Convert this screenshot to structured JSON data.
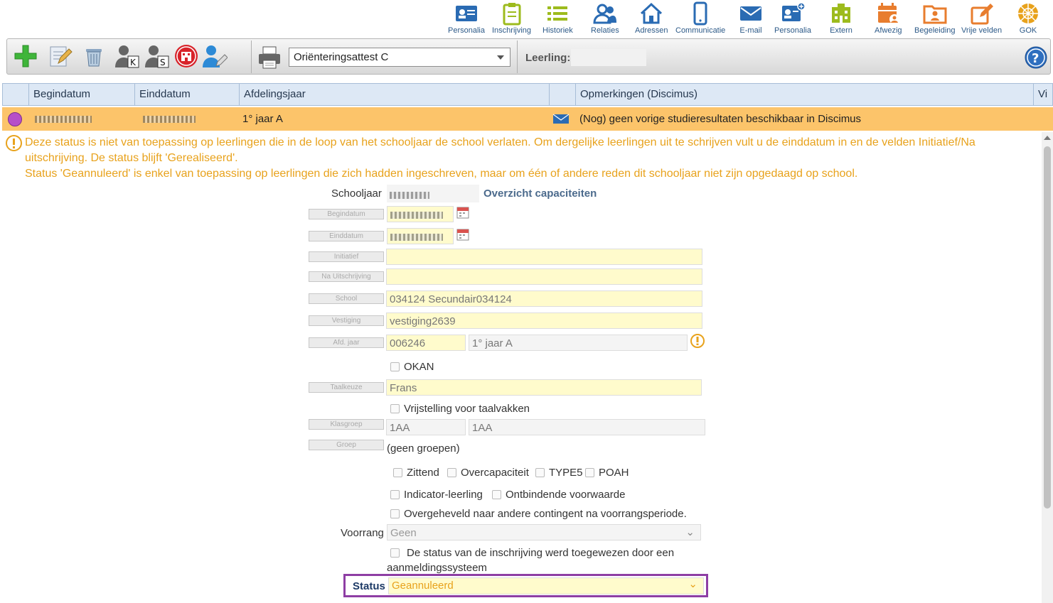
{
  "nav": [
    {
      "label": "Personalia",
      "icon": "id-card-icon"
    },
    {
      "label": "Inschrijving",
      "icon": "clipboard-icon"
    },
    {
      "label": "Historiek",
      "icon": "list-icon"
    },
    {
      "label": "Relaties",
      "icon": "users-icon"
    },
    {
      "label": "Adressen",
      "icon": "house-icon"
    },
    {
      "label": "Communicatie",
      "icon": "phone-icon"
    },
    {
      "label": "E-mail",
      "icon": "envelope-icon"
    },
    {
      "label": "Personalia",
      "icon": "id-card-plus-icon"
    },
    {
      "label": "Extern",
      "icon": "building-icon"
    },
    {
      "label": "Afwezig",
      "icon": "calendar-person-icon"
    },
    {
      "label": "Begeleiding",
      "icon": "folder-person-icon"
    },
    {
      "label": "Vrije velden",
      "icon": "edit-icon"
    },
    {
      "label": "GOK",
      "icon": "network-icon"
    }
  ],
  "toolbar": {
    "document_select": "Oriënteringsattest C",
    "leerling_label": "Leerling:"
  },
  "grid": {
    "columns": [
      "Begindatum",
      "Einddatum",
      "Afdelingsjaar",
      "Opmerkingen (Discimus)",
      "Vi"
    ],
    "row": {
      "afdelingsjaar": "1° jaar A",
      "opmerkingen": "(Nog) geen vorige studieresultaten beschikbaar in Discimus"
    }
  },
  "warning": {
    "line1": "Deze status is niet van toepassing op leerlingen die in de loop van het schooljaar de school verlaten. Om dergelijke leerlingen uit te schrijven vult u de einddatum in en de velden Initiatief/Na uitschrijving. De status blijft 'Gerealiseerd'.",
    "line2": "Status 'Geannuleerd' is enkel van toepassing op leerlingen die zich hadden ingeschreven, maar om één of andere reden dit schooljaar niet zijn opgedaagd op school."
  },
  "form": {
    "schooljaar_label": "Schooljaar",
    "capaciteit_link": "Overzicht capaciteiten",
    "begindatum_label": "Begindatum",
    "einddatum_label": "Einddatum",
    "initiatief_label": "Initiatief",
    "na_uitschrijving_label": "Na Uitschrijving",
    "school_label": "School",
    "school_value": "034124 Secundair034124",
    "vestiging_label": "Vestiging",
    "vestiging_value": "vestiging2639",
    "afd_label": "Afd. jaar",
    "afd_code": "006246",
    "afd_name": "1° jaar A",
    "okan": "OKAN",
    "taalkeuze_label": "Taalkeuze",
    "taalkeuze_value": "Frans",
    "vrijstelling": "Vrijstelling voor taalvakken",
    "klasgroep_label": "Klasgroep",
    "klasgroep_1": "1AA",
    "klasgroep_2": "1AA",
    "groep_label": "Groep",
    "groep_value": "(geen groepen)",
    "zittend": "Zittend",
    "overcapaciteit": "Overcapaciteit",
    "type5": "TYPE5",
    "poah": "POAH",
    "indicator": "Indicator-leerling",
    "ontbindende": "Ontbindende voorwaarde",
    "overgeheveld": "Overgeheveld naar andere contingent na voorrangsperiode.",
    "voorrang_label": "Voorrang",
    "voorrang_value": "Geen",
    "aanmelding_1": "De status van de inschrijving werd toegewezen door een",
    "aanmelding_2": "aanmeldingssysteem",
    "status_label": "Status",
    "status_value": "Geannuleerd"
  },
  "colors": {
    "accent": "#2d5a88",
    "warning": "#e8a21c",
    "row_highlight": "#fcc46a",
    "status_border": "#8e3ea4"
  }
}
